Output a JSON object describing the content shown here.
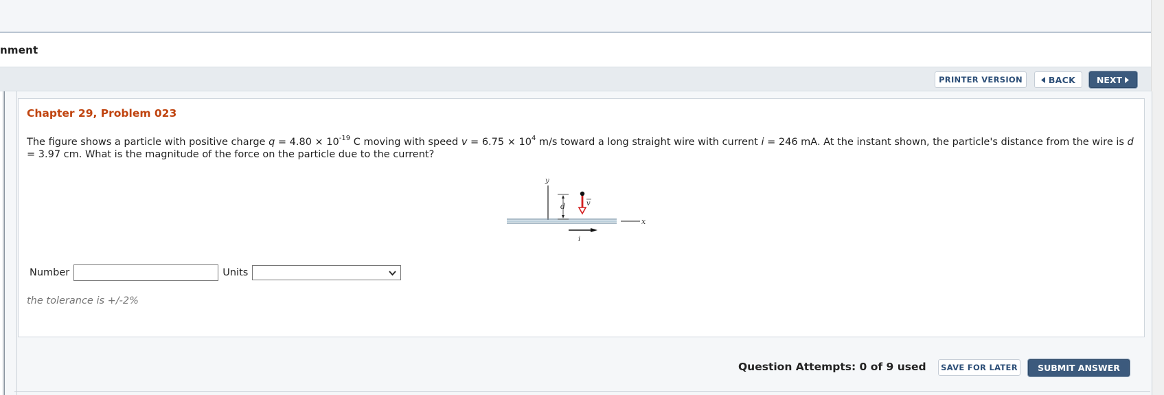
{
  "header": {
    "assignment_title": "nment"
  },
  "nav": {
    "printer_version": "PRINTER VERSION",
    "back_label": "BACK",
    "next_label": "NEXT",
    "back_icon": "triangle-left-icon",
    "next_icon": "triangle-right-icon"
  },
  "question": {
    "chapter_title": "Chapter 29, Problem 023",
    "text": {
      "p1": "The figure shows a particle with positive charge ",
      "q_var": "q",
      "p2": " = 4.80 × 10",
      "q_exp": "-19",
      "p3": " C moving with speed ",
      "v_var": "v",
      "p4": " = 6.75 × 10",
      "v_exp": "4",
      "p5": " m/s toward a long straight wire with current ",
      "i_var": "i",
      "p6": " = 246 mA. At the instant shown, the particle's distance from the wire is ",
      "d_var": "d",
      "p7": " = 3.97 cm. What is the magnitude of the force on the particle due to the current?"
    },
    "figure": {
      "label_y": "y",
      "label_x": "x",
      "label_d": "d",
      "label_v": "v",
      "label_i": "i",
      "particle_color": "#d42020"
    },
    "answer": {
      "number_label": "Number",
      "number_value": "",
      "units_label": "Units",
      "units_selected": ""
    },
    "tolerance": "the tolerance is +/-2%"
  },
  "footer": {
    "attempts": "Question Attempts: 0 of 9 used",
    "save_label": "SAVE FOR LATER",
    "submit_label": "SUBMIT ANSWER"
  },
  "colors": {
    "accent": "#c0440f",
    "button_dark": "#3c5a7d",
    "button_text_light": "#2d4f78"
  }
}
